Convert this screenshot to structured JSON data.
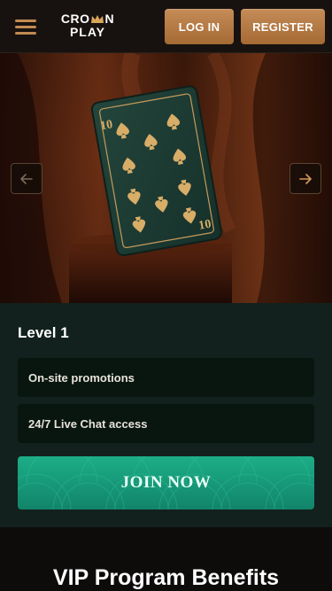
{
  "header": {
    "logo_line1_left": "CRO",
    "logo_line1_right": "N",
    "logo_line2": "PLAY",
    "login_label": "LOG IN",
    "register_label": "REGISTER"
  },
  "hero": {
    "card_rank": "10",
    "card_suit": "spades",
    "prev_icon": "arrow-left-icon",
    "next_icon": "arrow-right-icon"
  },
  "level": {
    "title": "Level 1",
    "perks": [
      "On-site promotions",
      "24/7 Live Chat access"
    ],
    "cta_label": "JOIN NOW"
  },
  "benefits": {
    "title": "VIP Program Benefits"
  },
  "colors": {
    "accent_bronze": "#b67a44",
    "accent_green": "#17a17d",
    "panel_bg": "#12211d",
    "perk_bg": "#08160f"
  }
}
